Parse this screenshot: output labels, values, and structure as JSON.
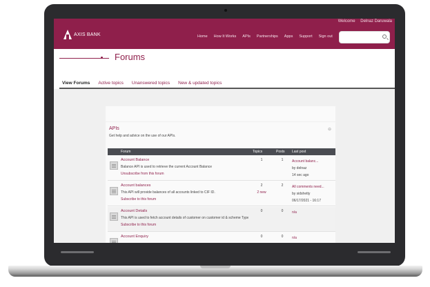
{
  "header": {
    "brand": "AXIS BANK",
    "user_links": [
      "Welcome",
      "Delnaz Daruwala"
    ],
    "nav": [
      "Home",
      "How It Works",
      "APIs",
      "Partnerships",
      "Apps",
      "Support",
      "Sign out"
    ],
    "search_placeholder": ""
  },
  "page": {
    "title": "Forums"
  },
  "tabs": [
    "View Forums",
    "Active topics",
    "Unanswered topics",
    "New & updated topics"
  ],
  "forum_category": {
    "name": "APIs",
    "description": "Get help and advice on the use of our APIs.",
    "collapse_glyph": "⊖"
  },
  "table": {
    "headers": [
      "Forum",
      "Topics",
      "Posts",
      "Last post"
    ],
    "rows": [
      {
        "title": "Account Balance",
        "description": "Balance API is used to retrieve the current Account Balance",
        "subscription": "Unsubscribe from this forum",
        "topics": "1",
        "new_topics": "",
        "posts": "1",
        "last_post_title": "Account balanc...",
        "last_post_by": "by delnaz",
        "last_post_time": "14 sec ago"
      },
      {
        "title": "Account balances",
        "description": "This API will provide balances of all accounts linked to CIF ID.",
        "subscription": "Subscribe to this forum",
        "topics": "2",
        "new_topics": "2 new",
        "posts": "2",
        "last_post_title": "All comments need...",
        "last_post_by": "by sidshetty",
        "last_post_time": "06/17/2021 - 16:17"
      },
      {
        "title": "Account Details",
        "description": "This API is used to fetch account details of customer on customer id & scheme Type basis.",
        "subscription": "Subscribe to this forum",
        "topics": "0",
        "new_topics": "",
        "posts": "0",
        "last_post_title": "n/a",
        "last_post_by": "",
        "last_post_time": ""
      },
      {
        "title": "Account Enquiry",
        "description": "",
        "subscription": "",
        "topics": "0",
        "new_topics": "",
        "posts": "0",
        "last_post_title": "n/a",
        "last_post_by": "",
        "last_post_time": ""
      }
    ]
  },
  "colors": {
    "brand": "#8f1f4b",
    "table_header": "#4a4c52",
    "bezel": "#2b2b2e"
  }
}
